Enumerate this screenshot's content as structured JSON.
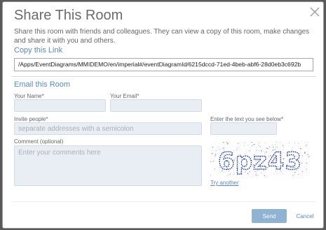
{
  "dialog": {
    "title": "Share This Room",
    "description": "Share this room with friends and colleagues. They can view a copy of this room, make changes and share it with you and others."
  },
  "copy_link": {
    "heading": "Copy this Link",
    "url": "/Apps/EventDiagrams/MMIDEMO/en/imperial#/eventDiagramId/6215dccd-71ed-4beb-abf6-28d0eb3c692b"
  },
  "email_room": {
    "heading": "Email this Room",
    "your_name_label": "Your Name*",
    "your_name_value": "",
    "your_email_label": "Your Email*",
    "your_email_value": "",
    "invite_label": "Invite people*",
    "invite_placeholder": "separate addresses with a semicolon",
    "captcha_label": "Enter the text you see below*",
    "captcha_value": "",
    "comment_label": "Comment (optional)",
    "comment_placeholder": "Enter your comments here",
    "captcha_text": "6pz43",
    "try_another": "Try another"
  },
  "buttons": {
    "send": "Send",
    "cancel": "Cancel"
  },
  "icons": {
    "close": "close-icon"
  },
  "colors": {
    "accent": "#5a89b8",
    "field_bg": "#e9eef4",
    "send_bg": "#8fb3d3",
    "captcha_ink": "#2a3f9c"
  }
}
